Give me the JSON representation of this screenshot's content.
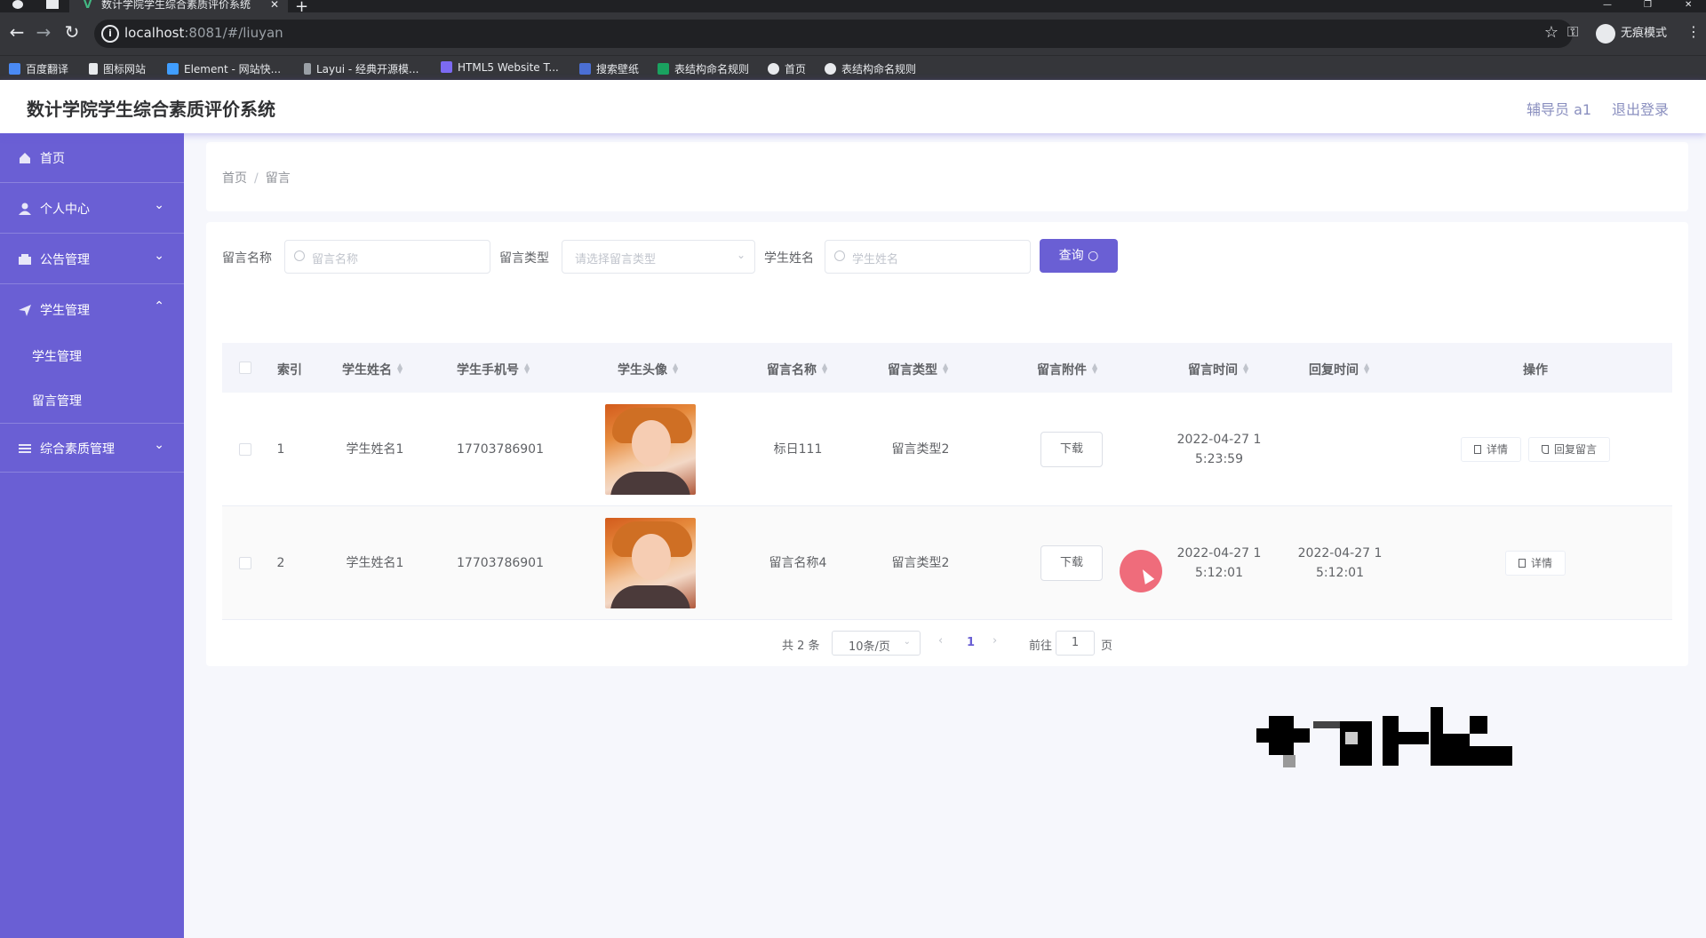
{
  "browser": {
    "tab_title": "数计学院学生综合素质评价系统",
    "url_host": "localhost",
    "url_rest": ":8081/#/liuyan",
    "incognito_label": "无痕模式",
    "bookmarks": [
      "百度翻译",
      "图标网站",
      "Element - 网站快...",
      "Layui - 经典开源模...",
      "HTML5 Website T...",
      "搜索壁纸",
      "表结构命名规则",
      "首页",
      "表结构命名规则"
    ]
  },
  "header": {
    "title": "数计学院学生综合素质评价系统",
    "role": "辅导员 a1",
    "logout": "退出登录"
  },
  "sidebar": {
    "items": [
      {
        "label": "首页",
        "icon": "home-icon"
      },
      {
        "label": "个人中心",
        "icon": "user-icon"
      },
      {
        "label": "公告管理",
        "icon": "notice-icon"
      },
      {
        "label": "学生管理",
        "icon": "send-icon"
      },
      {
        "label": "学生管理"
      },
      {
        "label": "留言管理"
      },
      {
        "label": "综合素质管理",
        "icon": "list-icon"
      }
    ]
  },
  "breadcrumb": [
    "首页",
    "留言"
  ],
  "search": {
    "name_label": "留言名称",
    "name_placeholder": "留言名称",
    "type_label": "留言类型",
    "type_placeholder": "请选择留言类型",
    "student_label": "学生姓名",
    "student_placeholder": "学生姓名",
    "query_button": "查询"
  },
  "table": {
    "columns": [
      "索引",
      "学生姓名",
      "学生手机号",
      "学生头像",
      "留言名称",
      "留言类型",
      "留言附件",
      "留言时间",
      "回复时间",
      "操作"
    ],
    "rows": [
      {
        "index": "1",
        "student_name": "学生姓名1",
        "phone": "17703786901",
        "title": "标日111",
        "type": "留言类型2",
        "attachment": "下载",
        "time": "2022-04-27 15:23:59",
        "reply_time": "",
        "actions": [
          "详情",
          "回复留言"
        ]
      },
      {
        "index": "2",
        "student_name": "学生姓名1",
        "phone": "17703786901",
        "title": "留言名称4",
        "type": "留言类型2",
        "attachment": "下载",
        "time": "2022-04-27 15:12:01",
        "reply_time": "2022-04-27 15:12:01",
        "actions": [
          "详情"
        ]
      }
    ]
  },
  "pagination": {
    "total": "共 2 条",
    "page_size": "10条/页",
    "current": "1",
    "goto_label": "前往",
    "goto_value": "1",
    "page_suffix": "页"
  },
  "colors": {
    "accent": "#6a5fd4",
    "sidebar": "#6a5fd4"
  }
}
